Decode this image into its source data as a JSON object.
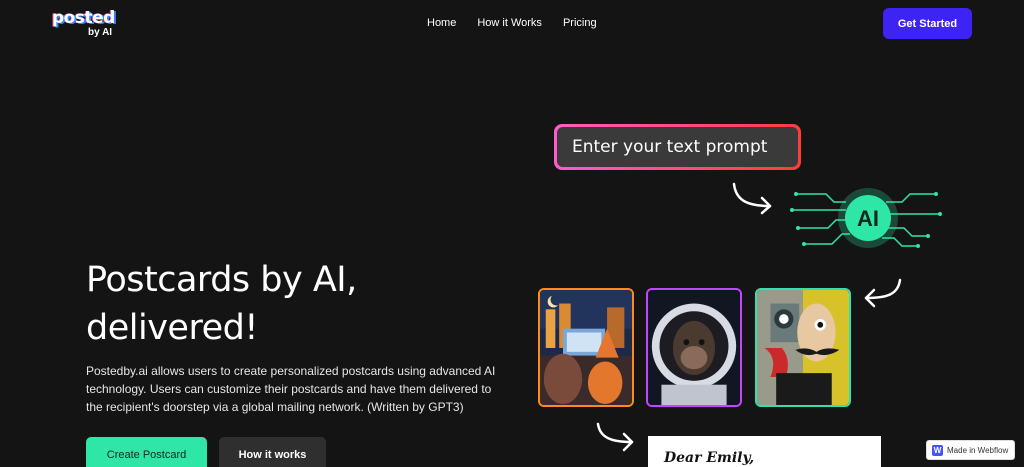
{
  "brand": {
    "logo_main": "posted",
    "logo_sub": "by AI"
  },
  "nav": {
    "items": [
      "Home",
      "How it Works",
      "Pricing"
    ],
    "cta": "Get Started"
  },
  "hero": {
    "title_line1": "Postcards by AI,",
    "title_line2": "delivered!",
    "description": "Postedby.ai allows users to create personalized postcards using advanced AI technology. Users can customize their postcards and have them delivered to the recipient's doorstep via a global mailing network. (Written by GPT3)",
    "primary_button": "Create Postcard",
    "secondary_button": "How it works"
  },
  "illustration": {
    "prompt_text": "Enter your text prompt",
    "ai_label": "AI",
    "letter_greeting": "Dear Emily,",
    "accent_green": "#2ee6a6",
    "accent_pink": "#ff5cc8"
  },
  "badge": {
    "label": "Made in Webflow",
    "icon_letter": "W"
  }
}
